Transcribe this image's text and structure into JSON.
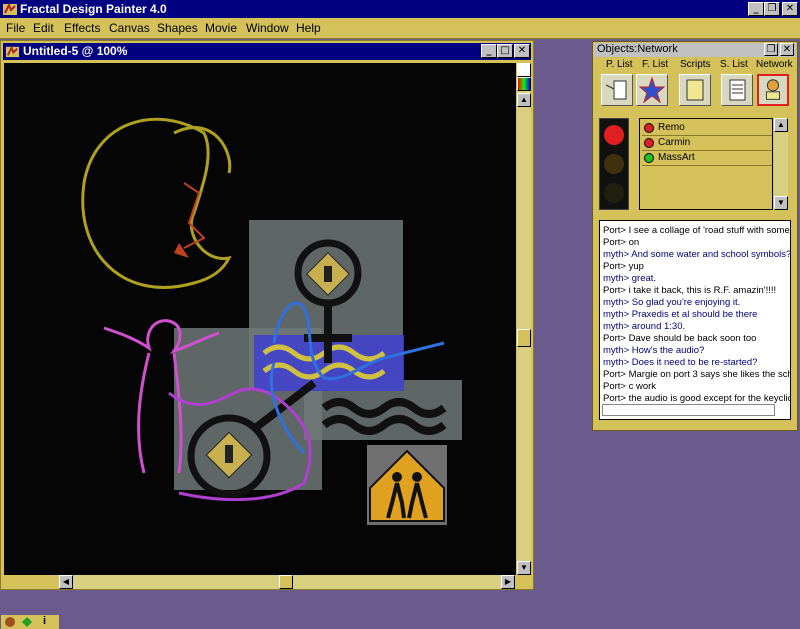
{
  "app": {
    "title": "Fractal Design Painter 4.0"
  },
  "menu": [
    "File",
    "Edit",
    "Effects",
    "Canvas",
    "Shapes",
    "Movie",
    "Window",
    "Help"
  ],
  "document": {
    "title": "Untitled-5 @ 100%"
  },
  "network": {
    "title": "Objects:Network",
    "tabs": [
      "P. List",
      "F. List",
      "Scripts",
      "S. List",
      "Network"
    ],
    "users": [
      {
        "name": "Remo",
        "color": "#e02020"
      },
      {
        "name": "Carmin",
        "color": "#e02020"
      },
      {
        "name": "MassArt",
        "color": "#20c020"
      }
    ],
    "chat": [
      {
        "who": "port",
        "text": "Port> I see a collage of 'road stuff with some"
      },
      {
        "who": "port",
        "text": "Port> on"
      },
      {
        "who": "myth",
        "text": "myth> And some water and school symbols?"
      },
      {
        "who": "port",
        "text": "Port> yup"
      },
      {
        "who": "myth",
        "text": "myth> great."
      },
      {
        "who": "port",
        "text": "Port> i take it back, this is R.F. amazin'!!!!"
      },
      {
        "who": "myth",
        "text": "myth> So glad you're enjoying it."
      },
      {
        "who": "myth",
        "text": "myth> Praxedis et al should be there"
      },
      {
        "who": "myth",
        "text": "myth> around 1:30."
      },
      {
        "who": "port",
        "text": "Port> Dave should be back soon too"
      },
      {
        "who": "myth",
        "text": "myth> How's the audio?"
      },
      {
        "who": "myth",
        "text": "myth> Does it need to be re-started?"
      },
      {
        "who": "port",
        "text": "Port> Margie on port 3 says she likes the sch"
      },
      {
        "who": "port",
        "text": "Port> c work"
      },
      {
        "who": "port",
        "text": "Port> the audio is good except for the keyclic"
      }
    ]
  },
  "status": {
    "info_label": "i"
  }
}
